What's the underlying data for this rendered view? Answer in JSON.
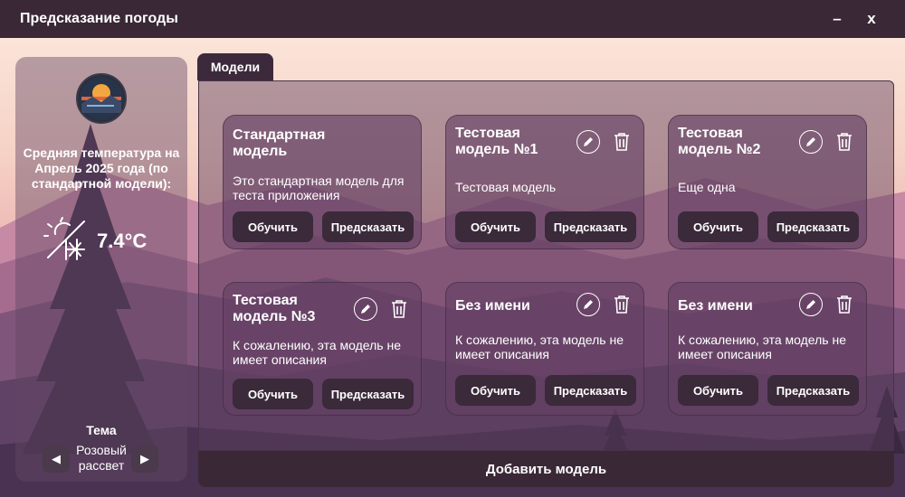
{
  "window": {
    "title": "Предсказание погоды",
    "minimize_label": "–",
    "close_label": "x"
  },
  "sidebar": {
    "avg_temp_label": "Средняя температура на Апрель 2025 года (по стандартной модели):",
    "temp_value": "7.4°C",
    "theme_label": "Тема",
    "theme_name": "Розовый рассвет",
    "prev_icon": "◀",
    "next_icon": "▶"
  },
  "tabs": [
    {
      "label": "Модели"
    }
  ],
  "models": [
    {
      "title": "Стандартная модель",
      "description": "Это стандартная модель для теста приложения",
      "train_label": "Обучить",
      "predict_label": "Предсказать",
      "editable": false
    },
    {
      "title": "Тестовая модель №1",
      "description": "Тестовая модель",
      "train_label": "Обучить",
      "predict_label": "Предсказать",
      "editable": true
    },
    {
      "title": "Тестовая модель №2",
      "description": "Еще одна",
      "train_label": "Обучить",
      "predict_label": "Предсказать",
      "editable": true
    },
    {
      "title": "Тестовая модель №3",
      "description": "К сожалению, эта модель не имеет описания",
      "train_label": "Обучить",
      "predict_label": "Предсказать",
      "editable": true
    },
    {
      "title": "Без имени",
      "description": "К сожалению, эта модель не имеет описания",
      "train_label": "Обучить",
      "predict_label": "Предсказать",
      "editable": true
    },
    {
      "title": "Без имени",
      "description": "К сожалению, эта модель не имеет описания",
      "train_label": "Обучить",
      "predict_label": "Предсказать",
      "editable": true
    }
  ],
  "add_model_label": "Добавить модель",
  "icons": {
    "edit": "pencil-icon",
    "delete": "trash-icon",
    "weather": "snowflake-sun-icon"
  },
  "colors": {
    "titlebar": "#3a2836",
    "button": "#3a2a3a",
    "card": "#64406a"
  }
}
